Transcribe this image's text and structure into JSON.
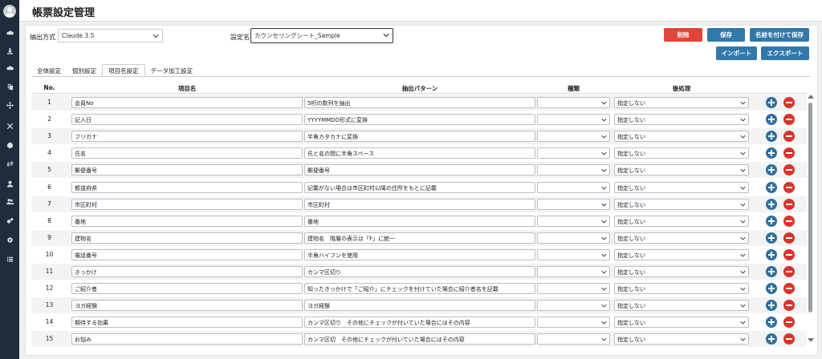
{
  "header": {
    "title": "帳票設定管理"
  },
  "sidebar": {
    "icons": [
      "cloud-upload-icon",
      "download-icon",
      "cloud-download-icon",
      "copy-icon",
      "move-icon",
      "tools-icon",
      "globe-icon",
      "exchange-icon",
      "user-icon",
      "users-icon",
      "cogs-icon",
      "gear-icon",
      "list-icon"
    ]
  },
  "filters": {
    "extract_label": "抽出方式",
    "extract_value": "Claude 3.5",
    "setting_label": "設定名",
    "setting_value": "カウンセリングシート_Sample"
  },
  "buttons": {
    "delete": "削除",
    "save": "保存",
    "save_as": "名前を付けて保存",
    "import": "インポート",
    "export": "エクスポート"
  },
  "tabs": [
    "全体設定",
    "個別設定",
    "項目名設定",
    "データ加工設定"
  ],
  "active_tab": 2,
  "table": {
    "headers": {
      "no": "No.",
      "item": "項目名",
      "pattern": "抽出パターン",
      "type": "種類",
      "post": "後処理"
    },
    "rows": [
      {
        "no": "1",
        "item": "会員No",
        "pattern": "5桁の数列を抽出",
        "type": "",
        "post": "指定しない"
      },
      {
        "no": "2",
        "item": "記入日",
        "pattern": "YYYYMMDD形式に変換",
        "type": "",
        "post": "指定しない"
      },
      {
        "no": "3",
        "item": "フリガナ",
        "pattern": "半角カタカナに変換",
        "type": "",
        "post": "指定しない"
      },
      {
        "no": "4",
        "item": "氏名",
        "pattern": "氏と名の間に半角スペース",
        "type": "",
        "post": "指定しない"
      },
      {
        "no": "5",
        "item": "郵便番号",
        "pattern": "郵便番号",
        "type": "",
        "post": "指定しない"
      },
      {
        "no": "6",
        "item": "都道府県",
        "pattern": "記載がない場合は市区町村以降の住所をもとに記載",
        "type": "",
        "post": "指定しない"
      },
      {
        "no": "7",
        "item": "市区町村",
        "pattern": "市区町村",
        "type": "",
        "post": "指定しない"
      },
      {
        "no": "8",
        "item": "番地",
        "pattern": "番地",
        "type": "",
        "post": "指定しない"
      },
      {
        "no": "9",
        "item": "建物名",
        "pattern": "建物名　階層の表示は「F」に統一",
        "type": "",
        "post": "指定しない"
      },
      {
        "no": "10",
        "item": "電話番号",
        "pattern": "半角ハイフンを使用",
        "type": "",
        "post": "指定しない"
      },
      {
        "no": "11",
        "item": "きっかけ",
        "pattern": "カンマ区切り",
        "type": "",
        "post": "指定しない"
      },
      {
        "no": "12",
        "item": "ご紹介者",
        "pattern": "知ったきっかけで「ご紹介」にチェックを付けていた場合に紹介者名を記載",
        "type": "",
        "post": "指定しない"
      },
      {
        "no": "13",
        "item": "ヨガ経験",
        "pattern": "ヨガ経験",
        "type": "",
        "post": "指定しない"
      },
      {
        "no": "14",
        "item": "期待する効果",
        "pattern": "カンマ区切り　その他にチェックが付いていた場合にはその内容",
        "type": "",
        "post": "指定しない"
      },
      {
        "no": "15",
        "item": "お悩み",
        "pattern": "カンマ区切　その他にチェックが付いていた場合にはその内容",
        "type": "",
        "post": "指定しない"
      }
    ]
  }
}
